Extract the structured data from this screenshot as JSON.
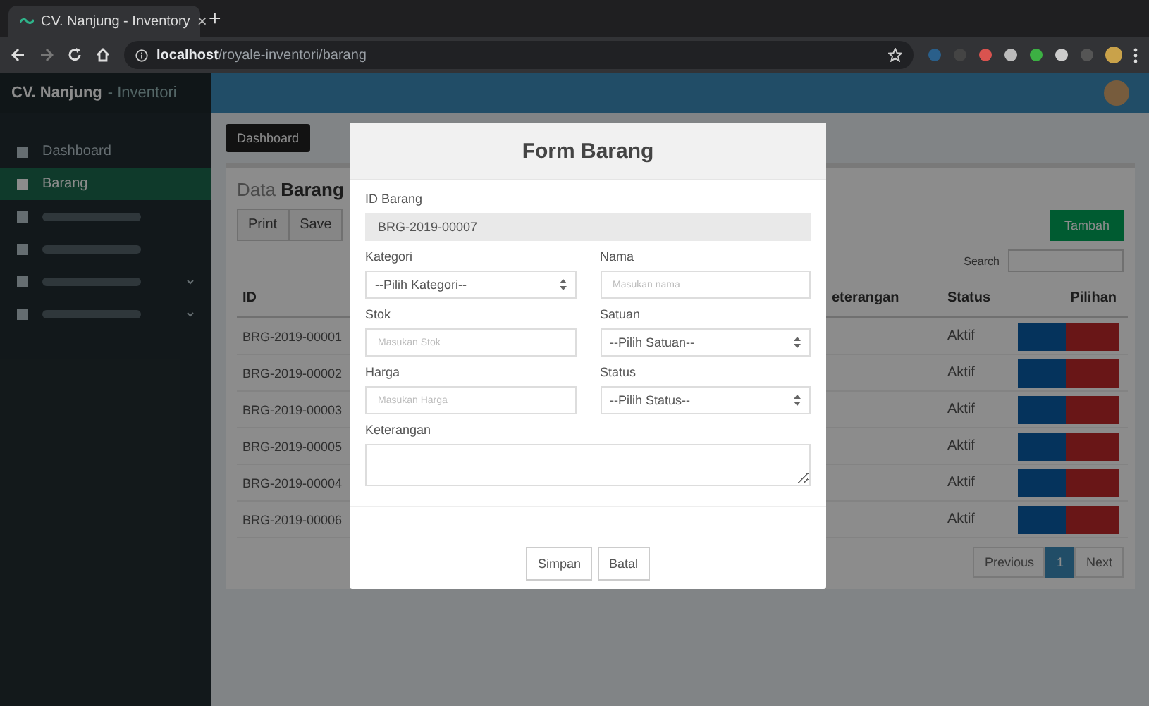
{
  "browser": {
    "tab_title": "CV. Nanjung - Inventory",
    "tab_close": "×",
    "new_tab": "+",
    "url_host": "localhost",
    "url_path": "/royale-inventori/barang"
  },
  "app": {
    "brand": "CV. Nanjung",
    "brand_suffix": "- Inventori"
  },
  "sidebar": {
    "items": [
      {
        "label": "Dashboard",
        "selected": false,
        "has_submenu": false
      },
      {
        "label": "Barang",
        "selected": true,
        "has_submenu": false
      },
      {
        "selected": false,
        "has_submenu": false
      },
      {
        "selected": false,
        "has_submenu": false
      },
      {
        "selected": false,
        "has_submenu": true
      },
      {
        "selected": false,
        "has_submenu": true
      }
    ]
  },
  "breadcrumb": {
    "label": "Dashboard"
  },
  "card": {
    "title_light": "Data",
    "title_bold": "Barang",
    "export_buttons": [
      "Print",
      "Save"
    ],
    "add_button": "Tambah",
    "search_label": "Search",
    "columns": [
      "ID",
      "",
      "eterangan",
      "Status",
      "Pilihan"
    ],
    "rows": [
      {
        "id": "BRG-2019-00001",
        "status": "Aktif"
      },
      {
        "id": "BRG-2019-00002",
        "status": "Aktif"
      },
      {
        "id": "BRG-2019-00003",
        "status": "Aktif"
      },
      {
        "id": "BRG-2019-00005",
        "status": "Aktif"
      },
      {
        "id": "BRG-2019-00004",
        "status": "Aktif"
      },
      {
        "id": "BRG-2019-00006",
        "status": "Aktif"
      }
    ],
    "pagination": [
      {
        "label": "Previous",
        "selected": false
      },
      {
        "label": "1",
        "selected": true
      },
      {
        "label": "Next",
        "selected": false
      }
    ]
  },
  "modal": {
    "title": "Form Barang",
    "fields": [
      {
        "label": "ID Barang",
        "kind": "text",
        "value": "BRG-2019-00007",
        "disabled": true,
        "wide": true
      },
      {
        "label": "Kategori",
        "kind": "select",
        "value": "--Pilih Kategori--",
        "disabled": false,
        "wide": false
      },
      {
        "label": "Nama",
        "kind": "text",
        "placeholder": "Masukan nama",
        "disabled": false,
        "wide": false
      },
      {
        "label": "Stok",
        "kind": "text",
        "placeholder": "Masukan Stok",
        "disabled": false,
        "wide": false
      },
      {
        "label": "Satuan",
        "kind": "select",
        "value": "--Pilih Satuan--",
        "disabled": false,
        "wide": false
      },
      {
        "label": "Harga",
        "kind": "text",
        "placeholder": "Masukan Harga",
        "disabled": false,
        "wide": false
      },
      {
        "label": "Status",
        "kind": "select",
        "value": "--Pilih Status--",
        "disabled": false,
        "wide": false
      },
      {
        "label": "Keterangan",
        "kind": "textarea",
        "disabled": false,
        "wide": true
      }
    ],
    "buttons": [
      "Simpan",
      "Batal"
    ]
  }
}
